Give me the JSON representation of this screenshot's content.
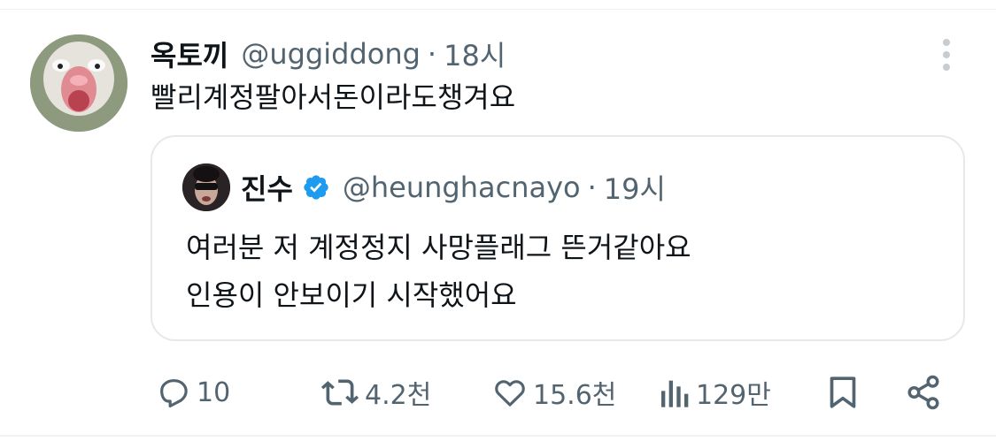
{
  "tweet": {
    "author": {
      "display_name": "옥토끼",
      "handle": "@uggiddong",
      "time": "18시"
    },
    "separator": "·",
    "text": "빨리계정팔아서돈이라도챙겨요",
    "more_icon": "more-vertical-icon"
  },
  "quote": {
    "author": {
      "display_name": "진수",
      "verified": true,
      "handle": "@heunghacnayo",
      "time": "19시"
    },
    "separator": "·",
    "lines": [
      "여러분 저 계정정지 사망플래그 뜬거같아요",
      "인용이 안보이기 시작했어요"
    ]
  },
  "actions": {
    "reply": {
      "icon": "reply-icon",
      "count": "10"
    },
    "repost": {
      "icon": "repost-icon",
      "count": "4.2천"
    },
    "like": {
      "icon": "heart-icon",
      "count": "15.6천"
    },
    "views": {
      "icon": "views-icon",
      "count": "129만"
    },
    "bookmark": {
      "icon": "bookmark-icon"
    },
    "share": {
      "icon": "share-icon"
    }
  },
  "colors": {
    "text": "#0f1419",
    "muted": "#536471",
    "verified": "#1d9bf0",
    "border": "#e6e9eb"
  }
}
